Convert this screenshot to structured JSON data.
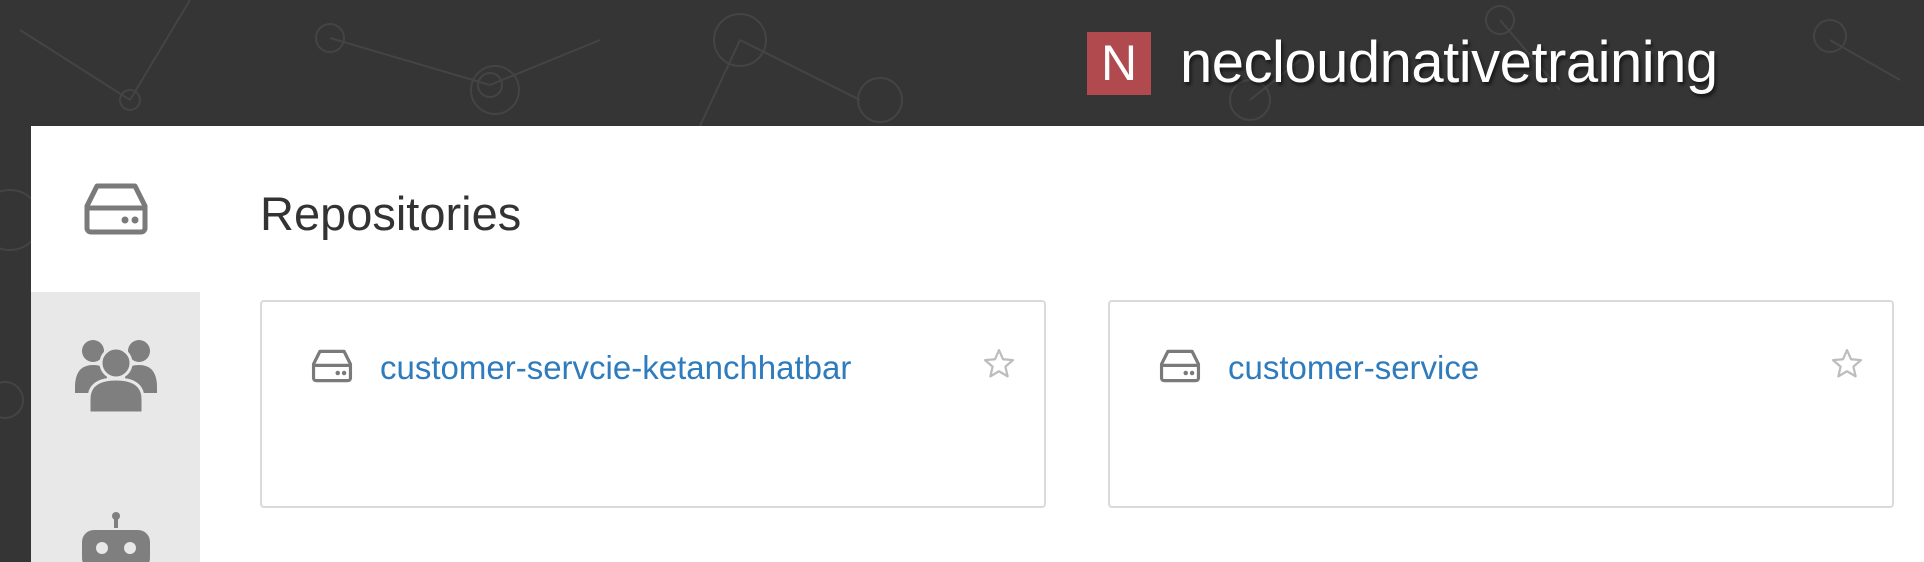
{
  "header": {
    "org_initial": "N",
    "org_name": "necloudnativetraining",
    "badge_color": "#b14a4f"
  },
  "sidebar": {
    "items": [
      {
        "icon": "repository-icon",
        "active": true
      },
      {
        "icon": "team-icon",
        "active": false
      },
      {
        "icon": "robot-icon",
        "active": false
      }
    ]
  },
  "main": {
    "title": "Repositories",
    "repositories": [
      {
        "name": "customer-servcie-ketanchhatbar",
        "icon": "repository-icon",
        "star_icon": "star-icon",
        "starred": false
      },
      {
        "name": "customer-service",
        "icon": "repository-icon",
        "star_icon": "star-icon",
        "starred": false
      }
    ]
  },
  "colors": {
    "background": "#353535",
    "link": "#2e7bbd",
    "sidebar_inactive": "#e8e8e8",
    "icon": "#808080"
  }
}
